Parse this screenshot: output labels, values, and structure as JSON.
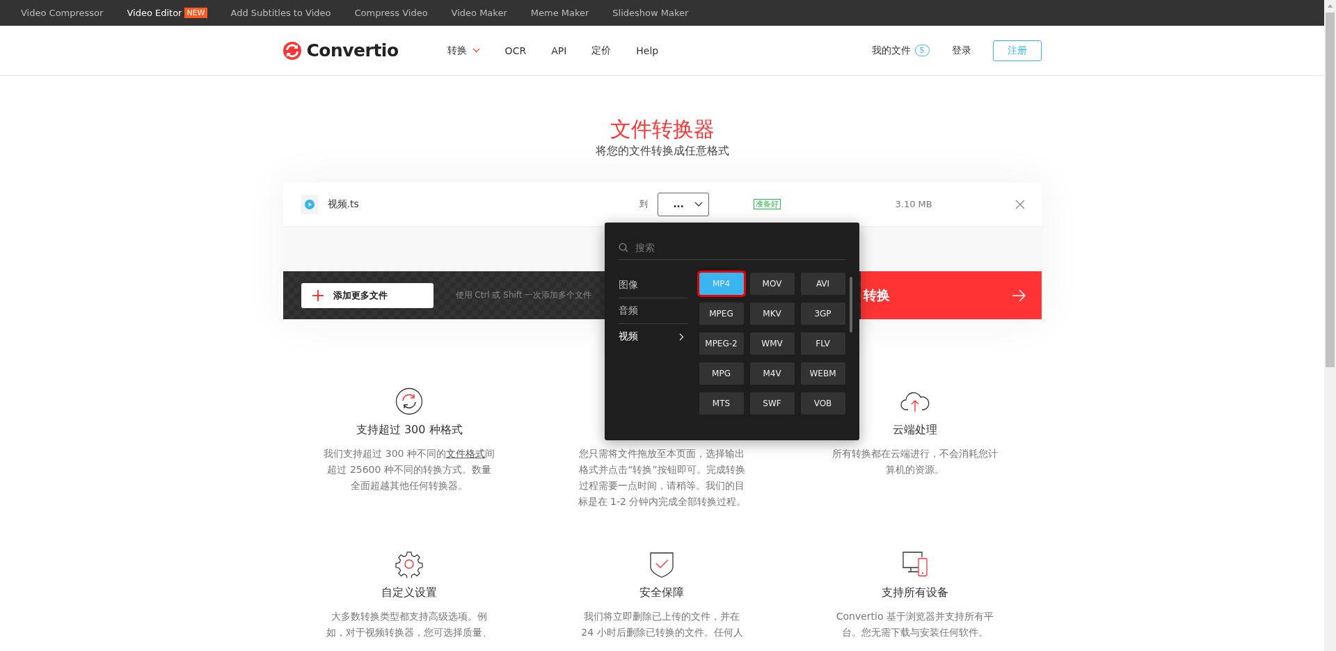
{
  "top_links": [
    {
      "label": "Video Compressor",
      "selected": false
    },
    {
      "label": "Video Editor",
      "selected": true,
      "badge": "NEW"
    },
    {
      "label": "Add Subtitles to Video",
      "selected": false
    },
    {
      "label": "Compress Video",
      "selected": false
    },
    {
      "label": "Video Maker",
      "selected": false
    },
    {
      "label": "Meme Maker",
      "selected": false
    },
    {
      "label": "Slideshow Maker",
      "selected": false
    }
  ],
  "header": {
    "logo": "Convertio",
    "nav": [
      {
        "label": "转换",
        "has_caret": true
      },
      {
        "label": "OCR",
        "has_caret": false
      },
      {
        "label": "API",
        "has_caret": false
      },
      {
        "label": "定价",
        "has_caret": false
      },
      {
        "label": "Help",
        "has_caret": false
      }
    ],
    "my_files": "我的文件",
    "my_files_count": "5",
    "login": "登录",
    "signup": "注册"
  },
  "hero": {
    "title": "文件转换器",
    "subtitle": "将您的文件转换成任意格式"
  },
  "file": {
    "name": "视频.ts",
    "to_label": "到",
    "target": "...",
    "status": "准备好",
    "size": "3.10 MB"
  },
  "actions": {
    "add_files": "添加更多文件",
    "hint": "使用 Ctrl 或 Shift 一次添加多个文件",
    "convert": "转换"
  },
  "dropdown": {
    "search_placeholder": "搜索",
    "categories": [
      {
        "label": "图像",
        "selected": false
      },
      {
        "label": "音频",
        "selected": false
      },
      {
        "label": "视频",
        "selected": true
      }
    ],
    "formats": [
      {
        "label": "MP4",
        "selected": true
      },
      {
        "label": "MOV",
        "selected": false
      },
      {
        "label": "AVI",
        "selected": false
      },
      {
        "label": "MPEG",
        "selected": false
      },
      {
        "label": "MKV",
        "selected": false
      },
      {
        "label": "3GP",
        "selected": false
      },
      {
        "label": "MPEG-2",
        "selected": false
      },
      {
        "label": "WMV",
        "selected": false
      },
      {
        "label": "FLV",
        "selected": false
      },
      {
        "label": "MPG",
        "selected": false
      },
      {
        "label": "M4V",
        "selected": false
      },
      {
        "label": "WEBM",
        "selected": false
      },
      {
        "label": "MTS",
        "selected": false
      },
      {
        "label": "SWF",
        "selected": false
      },
      {
        "label": "VOB",
        "selected": false
      }
    ]
  },
  "features": [
    {
      "kind": "formats",
      "title": "支持超过 300 种格式",
      "segments": [
        {
          "text": "我们支持超过 300 种不同的",
          "link": false
        },
        {
          "text": "文件格式",
          "link": true
        },
        {
          "text": "间超过 25600 种不同的转换方式。数量全面超越其他任何转换器。",
          "link": false
        }
      ]
    },
    {
      "kind": "covered",
      "segments": [
        {
          "text": "您只需将文件拖放至本页面，选择输出格式并点击“转换”按钮即可。完成转换过程需要一点时间，请稍等。我们的目标是在 1-2 分钟内完成全部转换过程。",
          "link": false
        }
      ]
    },
    {
      "kind": "cloud",
      "title": "云端处理",
      "segments": [
        {
          "text": "所有转换都在云端进行，不会消耗您计算机的资源。",
          "link": false
        }
      ]
    },
    {
      "kind": "settings",
      "title": "自定义设置",
      "segments": [
        {
          "text": "大多数转换类型都支持高级选项。例如，对于视频转换器，您可选择质量、",
          "link": false
        }
      ]
    },
    {
      "kind": "security",
      "title": "安全保障",
      "segments": [
        {
          "text": "我们将立即删除已上传的文件，并在 24 小时后删除已转换的文件。任何人",
          "link": false
        }
      ]
    },
    {
      "kind": "devices",
      "title": "支持所有设备",
      "segments": [
        {
          "text": "Convertio 基于浏览器并支持所有平台。您无需下载与安装任何软件。",
          "link": false
        }
      ]
    }
  ]
}
